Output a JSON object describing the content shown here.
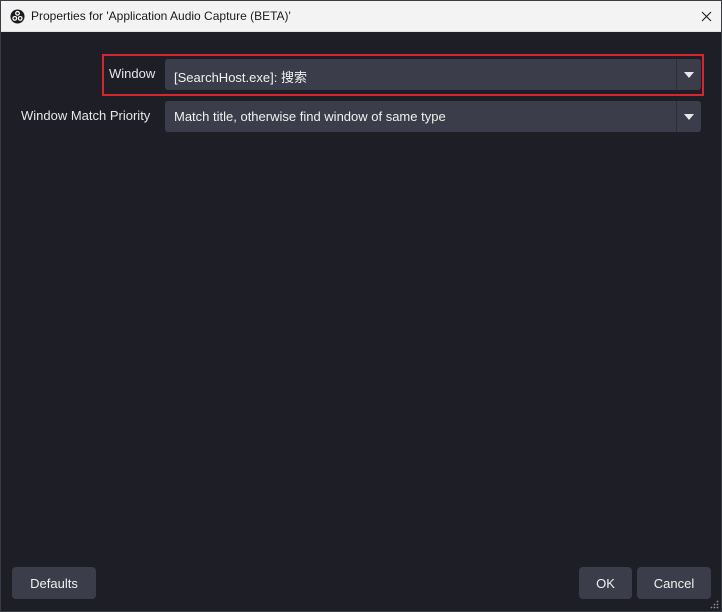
{
  "window": {
    "title": "Properties for 'Application Audio Capture (BETA)'"
  },
  "form": {
    "window_label": "Window",
    "window_value": "[SearchHost.exe]: 搜索",
    "priority_label": "Window Match Priority",
    "priority_value": "Match title, otherwise find window of same type"
  },
  "buttons": {
    "defaults": "Defaults",
    "ok": "OK",
    "cancel": "Cancel"
  },
  "colors": {
    "background": "#1e1f26",
    "control": "#3b3e4a",
    "highlight": "#d5262f",
    "titlebar": "#f3f3f3"
  },
  "icons": {
    "app": "obs-logo-icon",
    "close": "close-icon",
    "dropdown": "dropdown-arrow-icon",
    "resize": "resize-grip-icon"
  }
}
